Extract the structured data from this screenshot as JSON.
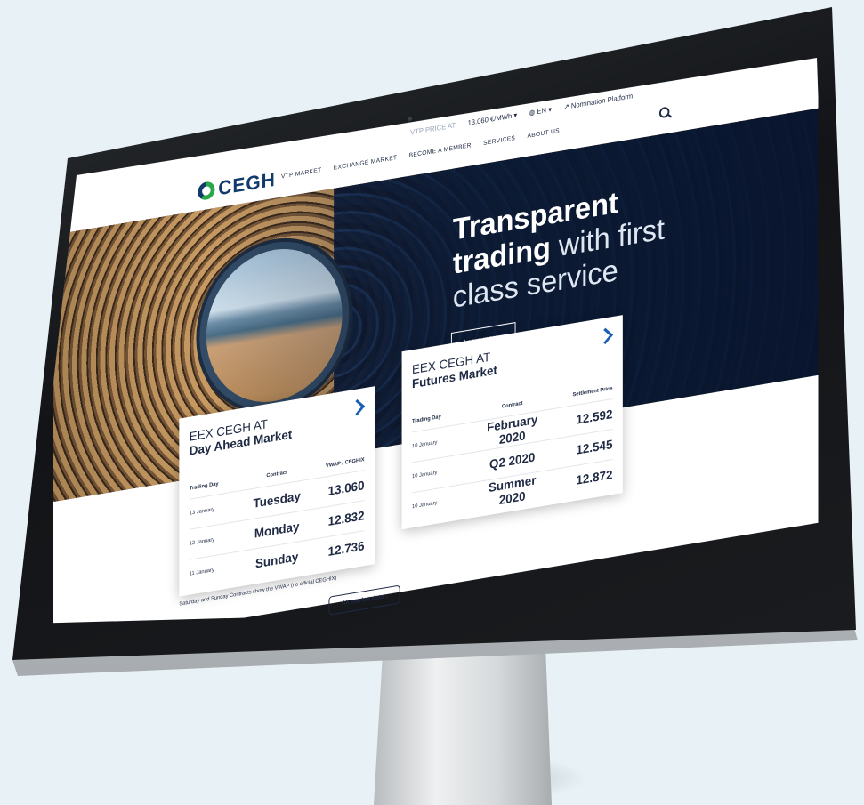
{
  "utility_bar": {
    "item_faded": "VTP PRICE AT",
    "price": "13.060 €/MWh",
    "language": "EN",
    "nomination": "Nomination Platform"
  },
  "nav": {
    "logo": "CEGH",
    "items": [
      "VTP MARKET",
      "EXCHANGE MARKET",
      "BECOME A MEMBER",
      "SERVICES",
      "ABOUT US"
    ]
  },
  "hero": {
    "title_bold": "Transparent",
    "title_line2_bold": "trading",
    "title_line2_rest": " with first",
    "title_line3": "class service",
    "cta": "Learn more"
  },
  "day_ahead": {
    "title_line1": "EEX CEGH AT",
    "title_line2": "Day Ahead Market",
    "col_day": "Trading Day",
    "col_contract": "Contract",
    "col_price": "VWAP / CEGHIX",
    "rows": [
      {
        "day": "13 January",
        "contract": "Tuesday",
        "value": "13.060"
      },
      {
        "day": "12 January",
        "contract": "Monday",
        "value": "12.832"
      },
      {
        "day": "11 January",
        "contract": "Sunday",
        "value": "12.736"
      }
    ]
  },
  "futures": {
    "title_line1": "EEX CEGH AT",
    "title_line2": "Futures Market",
    "col_day": "Trading Day",
    "col_contract": "Contract",
    "col_price": "Settlement Price",
    "rows": [
      {
        "day": "10 January",
        "contract": "February 2020",
        "value": "12.592"
      },
      {
        "day": "10 January",
        "contract": "Q2 2020",
        "value": "12.545"
      },
      {
        "day": "10 January",
        "contract": "Summer 2020",
        "value": "12.872"
      }
    ]
  },
  "footnote": "Saturday and Sunday Contracts show the VWAP (no official CEGHIX)",
  "all_market_button": "All market data"
}
